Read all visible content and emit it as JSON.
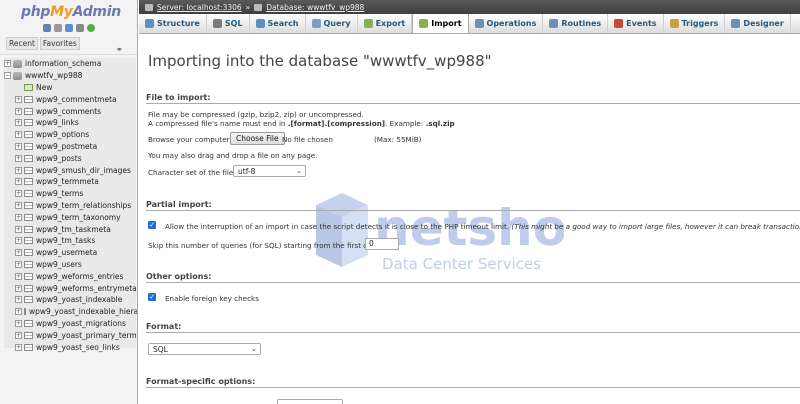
{
  "sidebar": {
    "logo": {
      "php": "php",
      "my": "My",
      "admin": "Admin"
    },
    "quick_icons": [
      "home-icon",
      "logout-icon",
      "help-icon",
      "settings-icon",
      "reload-icon"
    ],
    "tabs": [
      "Recent",
      "Favorites"
    ],
    "tree": [
      {
        "label": "information_schema",
        "type": "db",
        "level": 1
      },
      {
        "label": "wwwtfv_wp988",
        "type": "db",
        "level": 1
      },
      {
        "label": "New",
        "type": "new",
        "level": 2
      },
      {
        "label": "wpw9_commentmeta",
        "type": "table",
        "level": 2
      },
      {
        "label": "wpw9_comments",
        "type": "table",
        "level": 2
      },
      {
        "label": "wpw9_links",
        "type": "table",
        "level": 2
      },
      {
        "label": "wpw9_options",
        "type": "table",
        "level": 2
      },
      {
        "label": "wpw9_postmeta",
        "type": "table",
        "level": 2
      },
      {
        "label": "wpw9_posts",
        "type": "table",
        "level": 2
      },
      {
        "label": "wpw9_smush_dir_images",
        "type": "table",
        "level": 2
      },
      {
        "label": "wpw9_termmeta",
        "type": "table",
        "level": 2
      },
      {
        "label": "wpw9_terms",
        "type": "table",
        "level": 2
      },
      {
        "label": "wpw9_term_relationships",
        "type": "table",
        "level": 2
      },
      {
        "label": "wpw9_term_taxonomy",
        "type": "table",
        "level": 2
      },
      {
        "label": "wpw9_tm_taskmeta",
        "type": "table",
        "level": 2
      },
      {
        "label": "wpw9_tm_tasks",
        "type": "table",
        "level": 2
      },
      {
        "label": "wpw9_usermeta",
        "type": "table",
        "level": 2
      },
      {
        "label": "wpw9_users",
        "type": "table",
        "level": 2
      },
      {
        "label": "wpw9_weforms_entries",
        "type": "table",
        "level": 2
      },
      {
        "label": "wpw9_weforms_entrymeta",
        "type": "table",
        "level": 2
      },
      {
        "label": "wpw9_yoast_indexable",
        "type": "table",
        "level": 2
      },
      {
        "label": "wpw9_yoast_indexable_hiera",
        "type": "table",
        "level": 2
      },
      {
        "label": "wpw9_yoast_migrations",
        "type": "table",
        "level": 2
      },
      {
        "label": "wpw9_yoast_primary_term",
        "type": "table",
        "level": 2
      },
      {
        "label": "wpw9_yoast_seo_links",
        "type": "table",
        "level": 2
      }
    ]
  },
  "topbar": {
    "server": "Server: localhost:3306",
    "separator": "»",
    "database": "Database: wwwtfv_wp988"
  },
  "tabs": [
    {
      "label": "Structure",
      "icon": "structure-icon",
      "color": "#5b8fc7"
    },
    {
      "label": "SQL",
      "icon": "sql-icon",
      "color": "#7a7a7a"
    },
    {
      "label": "Search",
      "icon": "search-icon",
      "color": "#5b8fc7"
    },
    {
      "label": "Query",
      "icon": "query-icon",
      "color": "#7a9fc7"
    },
    {
      "label": "Export",
      "icon": "export-icon",
      "color": "#8bb04f"
    },
    {
      "label": "Import",
      "icon": "import-icon",
      "color": "#8bb04f",
      "active": true
    },
    {
      "label": "Operations",
      "icon": "operations-icon",
      "color": "#6b8fb5"
    },
    {
      "label": "Routines",
      "icon": "routines-icon",
      "color": "#6b8fb5"
    },
    {
      "label": "Events",
      "icon": "events-icon",
      "color": "#c94a3a"
    },
    {
      "label": "Triggers",
      "icon": "triggers-icon",
      "color": "#c9a23a"
    },
    {
      "label": "Designer",
      "icon": "designer-icon",
      "color": "#6b8fb5"
    }
  ],
  "main": {
    "title": "Importing into the database \"wwwtfv_wp988\"",
    "file_section": {
      "heading": "File to import:",
      "compressed_note": "File may be compressed (gzip, bzip2, zip) or uncompressed.",
      "ext_note_prefix": "A compressed file's name must end in ",
      "ext_note_format": ".[format].[compression]",
      "ext_note_example_prefix": ". Example: ",
      "ext_note_example": ".sql.zip",
      "browse_label": "Browse your computer:",
      "choose_button": "Choose File",
      "no_file": "No file chosen",
      "max_size": "(Max: 55MiB)",
      "drag_note": "You may also drag and drop a file on any page.",
      "charset_label": "Character set of the file:",
      "charset_value": "utf-8"
    },
    "partial_section": {
      "heading": "Partial import:",
      "allow_interrupt_label": "Allow the interruption of an import in case the script detects it is close to the PHP timeout limit.",
      "allow_interrupt_note": "(This might be a good way to import large files, however it can break transactions.)",
      "skip_label": "Skip this number of queries (for SQL) starting from the first one:",
      "skip_value": "0"
    },
    "other_section": {
      "heading": "Other options:",
      "foreign_key_label": "Enable foreign key checks"
    },
    "format_section": {
      "heading": "Format:",
      "format_value": "SQL"
    },
    "format_specific_section": {
      "heading": "Format-specific options:"
    },
    "watermark": {
      "brand": "netshop",
      "tagline": "Data Center Services"
    }
  }
}
